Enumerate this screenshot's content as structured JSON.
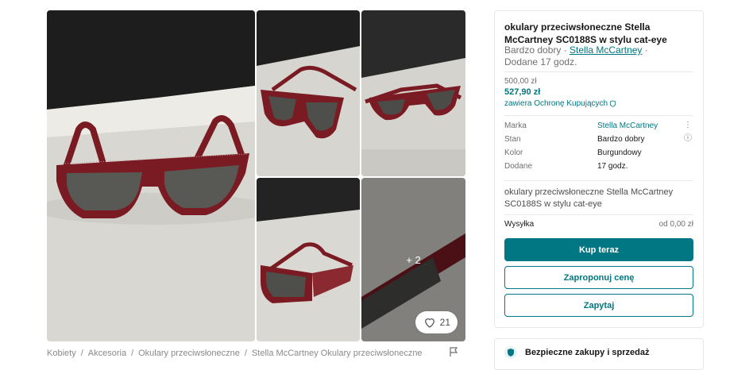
{
  "gallery": {
    "more_photos_label": "+ 2",
    "favourite_count": "21"
  },
  "breadcrumb": [
    "Kobiety",
    "Akcesoria",
    "Okulary przeciwsłoneczne",
    "Stella McCartney Okulary przeciwsłoneczne"
  ],
  "item": {
    "title": "okulary przeciwsłoneczne Stella McCartney SC0188S w stylu cat-eye",
    "condition": "Bardzo dobry · ",
    "brand_link": "Stella McCartney",
    "meta_suffix": " ·",
    "uploaded": "Dodane 17 godz.",
    "old_price": "500,00 zł",
    "price": "527,90 zł",
    "protection": "zawiera Ochronę Kupujących",
    "attributes": [
      {
        "key": "Marka",
        "value": "Stella McCartney"
      },
      {
        "key": "Stan",
        "value": "Bardzo dobry"
      },
      {
        "key": "Kolor",
        "value": "Burgundowy"
      },
      {
        "key": "Dodane",
        "value": "17 godz."
      }
    ],
    "description": "okulary przeciwsłoneczne Stella McCartney SC0188S w stylu cat-eye",
    "shipping_label": "Wysyłka",
    "shipping_value": "od 0,00 zł"
  },
  "actions": {
    "buy_now": "Kup teraz",
    "make_offer": "Zaproponuj cenę",
    "ask": "Zapytaj"
  },
  "safety": {
    "title": "Bezpieczne zakupy i sprzedaż"
  },
  "colors": {
    "accent": "#007782",
    "frame": "#7a1a22"
  }
}
